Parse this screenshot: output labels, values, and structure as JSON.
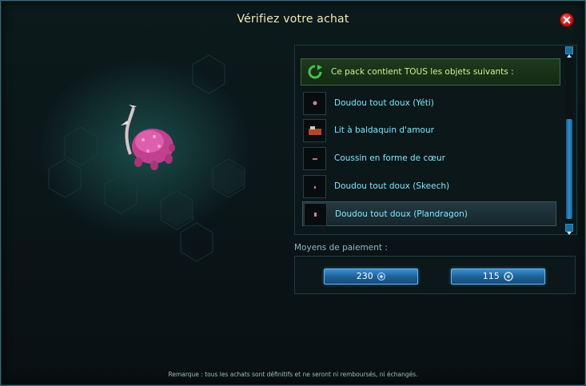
{
  "window": {
    "title": "Vérifiez votre achat"
  },
  "pack": {
    "header": "Ce pack contient TOUS les objets suivants :",
    "items": [
      {
        "label": "Doudou tout doux (Yéti)",
        "selected": false
      },
      {
        "label": "Lit à baldaquin d'amour",
        "selected": false
      },
      {
        "label": "Coussin en forme de cœur",
        "selected": false
      },
      {
        "label": "Doudou tout doux (Skeech)",
        "selected": false
      },
      {
        "label": "Doudou tout doux (Plandragon)",
        "selected": true
      }
    ]
  },
  "payment": {
    "label": "Moyens de paiement :",
    "options": [
      {
        "amount": "230",
        "currency_icon": "ogrine-icon"
      },
      {
        "amount": "115",
        "currency_icon": "kama-icon"
      }
    ]
  },
  "remark": "Remarque : tous les achats sont définitifs et ne seront ni remboursés, ni échangés.",
  "colors": {
    "accent": "#2c8fd0",
    "item_text": "#7fe6ff",
    "header_text": "#c9f28f",
    "title": "#f4e8b8"
  }
}
